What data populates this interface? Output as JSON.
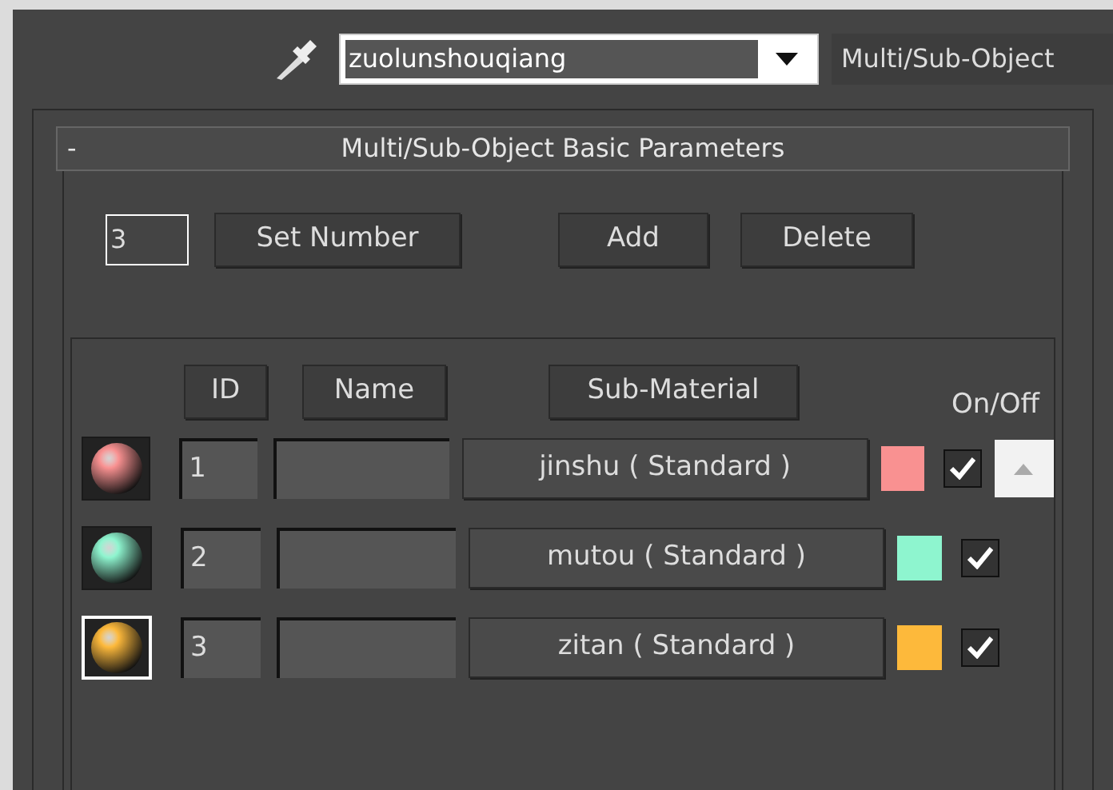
{
  "toolbar": {
    "material_name": "zuolunshouqiang",
    "material_type": "Multi/Sub-Object"
  },
  "rollout": {
    "collapse_glyph": "-",
    "title": "Multi/Sub-Object Basic Parameters"
  },
  "count": {
    "value": "3",
    "set_button": "Set Number",
    "add_button": "Add",
    "delete_button": "Delete"
  },
  "columns": {
    "id": "ID",
    "name": "Name",
    "sub_material": "Sub-Material",
    "on_off": "On/Off"
  },
  "rows": [
    {
      "id": "1",
      "sub_material": "jinshu ( Standard )",
      "color": "#f99191",
      "on": true,
      "selected": false
    },
    {
      "id": "2",
      "sub_material": "mutou ( Standard )",
      "color": "#8ef5cf",
      "on": true,
      "selected": false
    },
    {
      "id": "3",
      "sub_material": "zitan ( Standard )",
      "color": "#fdb93b",
      "on": true,
      "selected": true
    }
  ]
}
